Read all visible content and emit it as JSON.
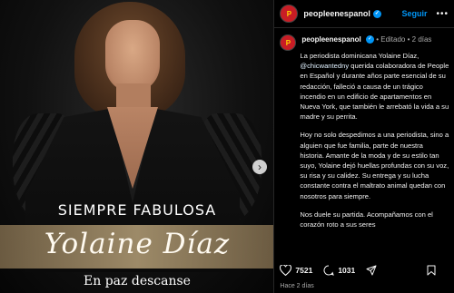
{
  "image": {
    "tagline": "SIEMPRE FABULOSA",
    "name": "Yolaine Díaz",
    "subtitle": "En paz descanse"
  },
  "header": {
    "username": "peopleenespanol",
    "follow_label": "Seguir",
    "more_label": "•••"
  },
  "caption": {
    "username": "peopleenespanol",
    "edited": "• Editado •",
    "time": "2 días",
    "p1_start": "La periodista dominicana Yolaine Díaz,",
    "mention": "@chicwantedny",
    "p1_rest": "querida colaboradora de People en Español y durante años parte esencial de su redacción, falleció a causa de un trágico incendio en un edificio de apartamentos en Nueva York, que también le arrebató la vida a su madre y su perrita.",
    "p2": "Hoy no solo despedimos a una periodista, sino a alguien que fue familia, parte de nuestra historia. Amante de la moda y de su estilo tan suyo, Yolaine dejó huellas profundas con su voz, su risa y su calidez. Su entrega y su lucha constante contra el maltrato animal quedan con nosotros para siempre.",
    "p3": "Nos duele su partida. Acompañamos con el corazón roto a sus seres"
  },
  "actions": {
    "likes": "7521",
    "comments": "1031"
  },
  "footer": {
    "time_ago": "Hace 2 días"
  },
  "colors": {
    "accent": "#0095f6",
    "brand_red": "#c81d25",
    "brand_yellow": "#ffd400"
  }
}
